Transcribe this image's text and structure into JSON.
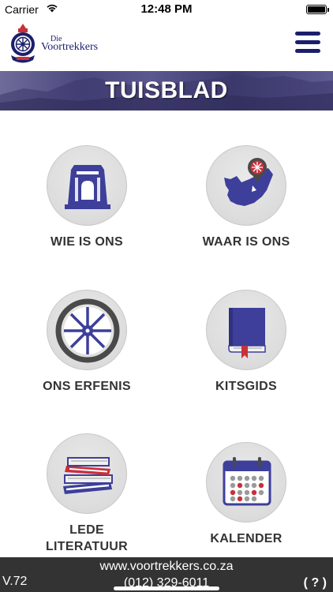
{
  "status_bar": {
    "carrier": "Carrier",
    "time": "12:48 PM"
  },
  "header": {
    "logo_small_text": "Die",
    "logo_big_text": "Voortrekkers",
    "menu_icon": "hamburger-icon"
  },
  "banner": {
    "title": "TUISBLAD"
  },
  "tiles": [
    {
      "label": "WIE IS ONS",
      "icon": "monument-icon"
    },
    {
      "label": "WAAR IS ONS",
      "icon": "map-pin-icon"
    },
    {
      "label": "ONS ERFENIS",
      "icon": "wagon-wheel-icon"
    },
    {
      "label": "KITSGIDS",
      "icon": "book-icon"
    },
    {
      "label_line1": "LEDE",
      "label_line2": "LITERATUUR",
      "icon": "books-stack-icon"
    },
    {
      "label": "KALENDER",
      "icon": "calendar-icon"
    }
  ],
  "footer": {
    "url": "www.voortrekkers.co.za",
    "phone": "(012) 329-6011",
    "version": "V.72",
    "help": "( ? )"
  },
  "colors": {
    "brand_navy": "#1b1f6b",
    "icon_blue": "#3d3f9a",
    "accent_red": "#c9303a",
    "footer_bg": "#333333"
  }
}
